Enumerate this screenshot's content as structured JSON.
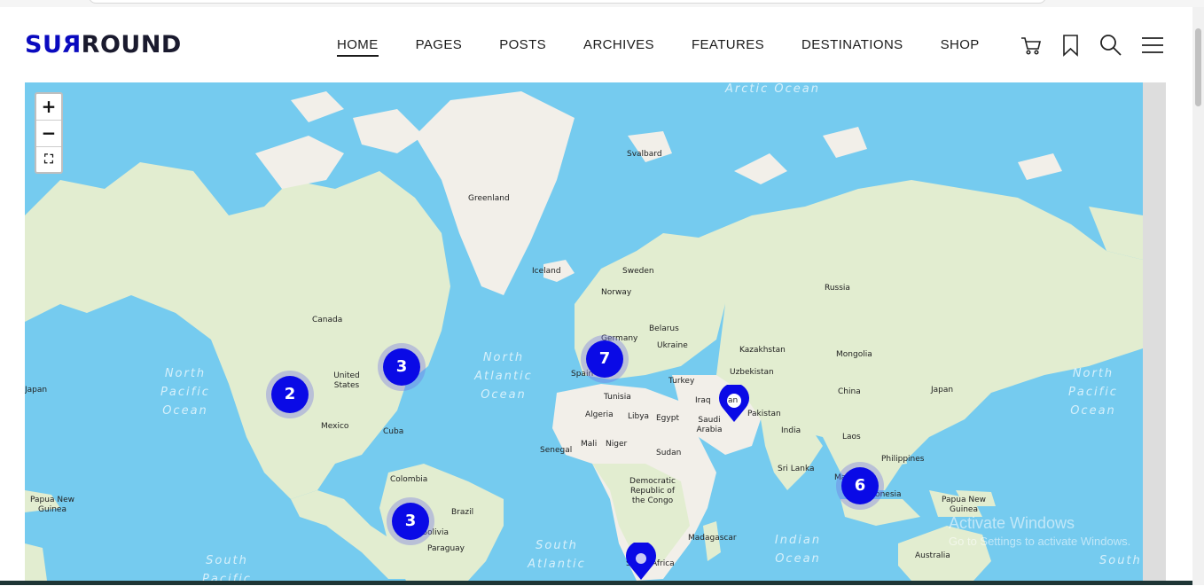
{
  "brand": {
    "logo_a": "SU",
    "logo_b": "R",
    "logo_c": "ROUND"
  },
  "nav": [
    {
      "label": "HOME",
      "active": true
    },
    {
      "label": "PAGES"
    },
    {
      "label": "POSTS"
    },
    {
      "label": "ARCHIVES"
    },
    {
      "label": "FEATURES"
    },
    {
      "label": "DESTINATIONS"
    },
    {
      "label": "SHOP"
    }
  ],
  "header_icons": [
    "cart-icon",
    "bookmark-icon",
    "search-icon",
    "menu-icon"
  ],
  "map": {
    "zoom_in": "+",
    "zoom_out": "−",
    "fullscreen": "⛶",
    "land_color": "#f2efe9",
    "green_color": "#e2edd0",
    "water_color": "#75cbef",
    "cluster_color": "#0a0ae6",
    "clusters": [
      {
        "count": "2"
      },
      {
        "count": "3"
      },
      {
        "count": "7"
      },
      {
        "count": "6"
      },
      {
        "count": "3"
      }
    ],
    "pins": [
      {
        "label": "an"
      },
      {
        "label": ""
      }
    ],
    "countries": [
      "Greenland",
      "Svalbard",
      "Iceland",
      "Sweden",
      "Norway",
      "Russia",
      "Canada",
      "United States",
      "Germany",
      "Belarus",
      "Ukraine",
      "Kazakhstan",
      "Mongolia",
      "Uzbekistan",
      "Turkey",
      "China",
      "Japan",
      "Japan",
      "Spain",
      "Tunisia",
      "Iraq",
      "Pakistan",
      "Mexico",
      "Algeria",
      "Libya",
      "Egypt",
      "Saudi Arabia",
      "India",
      "Cuba",
      "Laos",
      "Mali",
      "Niger",
      "Senegal",
      "Sudan",
      "Sri Lanka",
      "Philippines",
      "Colombia",
      "Democratic Republic of the Congo",
      "Ma",
      "Indonesia",
      "Papua New Guinea",
      "Papua New Guinea",
      "Brazil",
      "Bolivia",
      "Paraguay",
      "Madagascar",
      "South Africa",
      "Australia"
    ],
    "oceans": [
      "Arctic Ocean",
      "North Pacific Ocean",
      "North Atlantic Ocean",
      "North Pacific Ocean",
      "South Atlantic",
      "Indian Ocean",
      "South Pacific",
      "South"
    ]
  },
  "watermark": {
    "title": "Activate Windows",
    "subtitle": "Go to Settings to activate Windows."
  }
}
